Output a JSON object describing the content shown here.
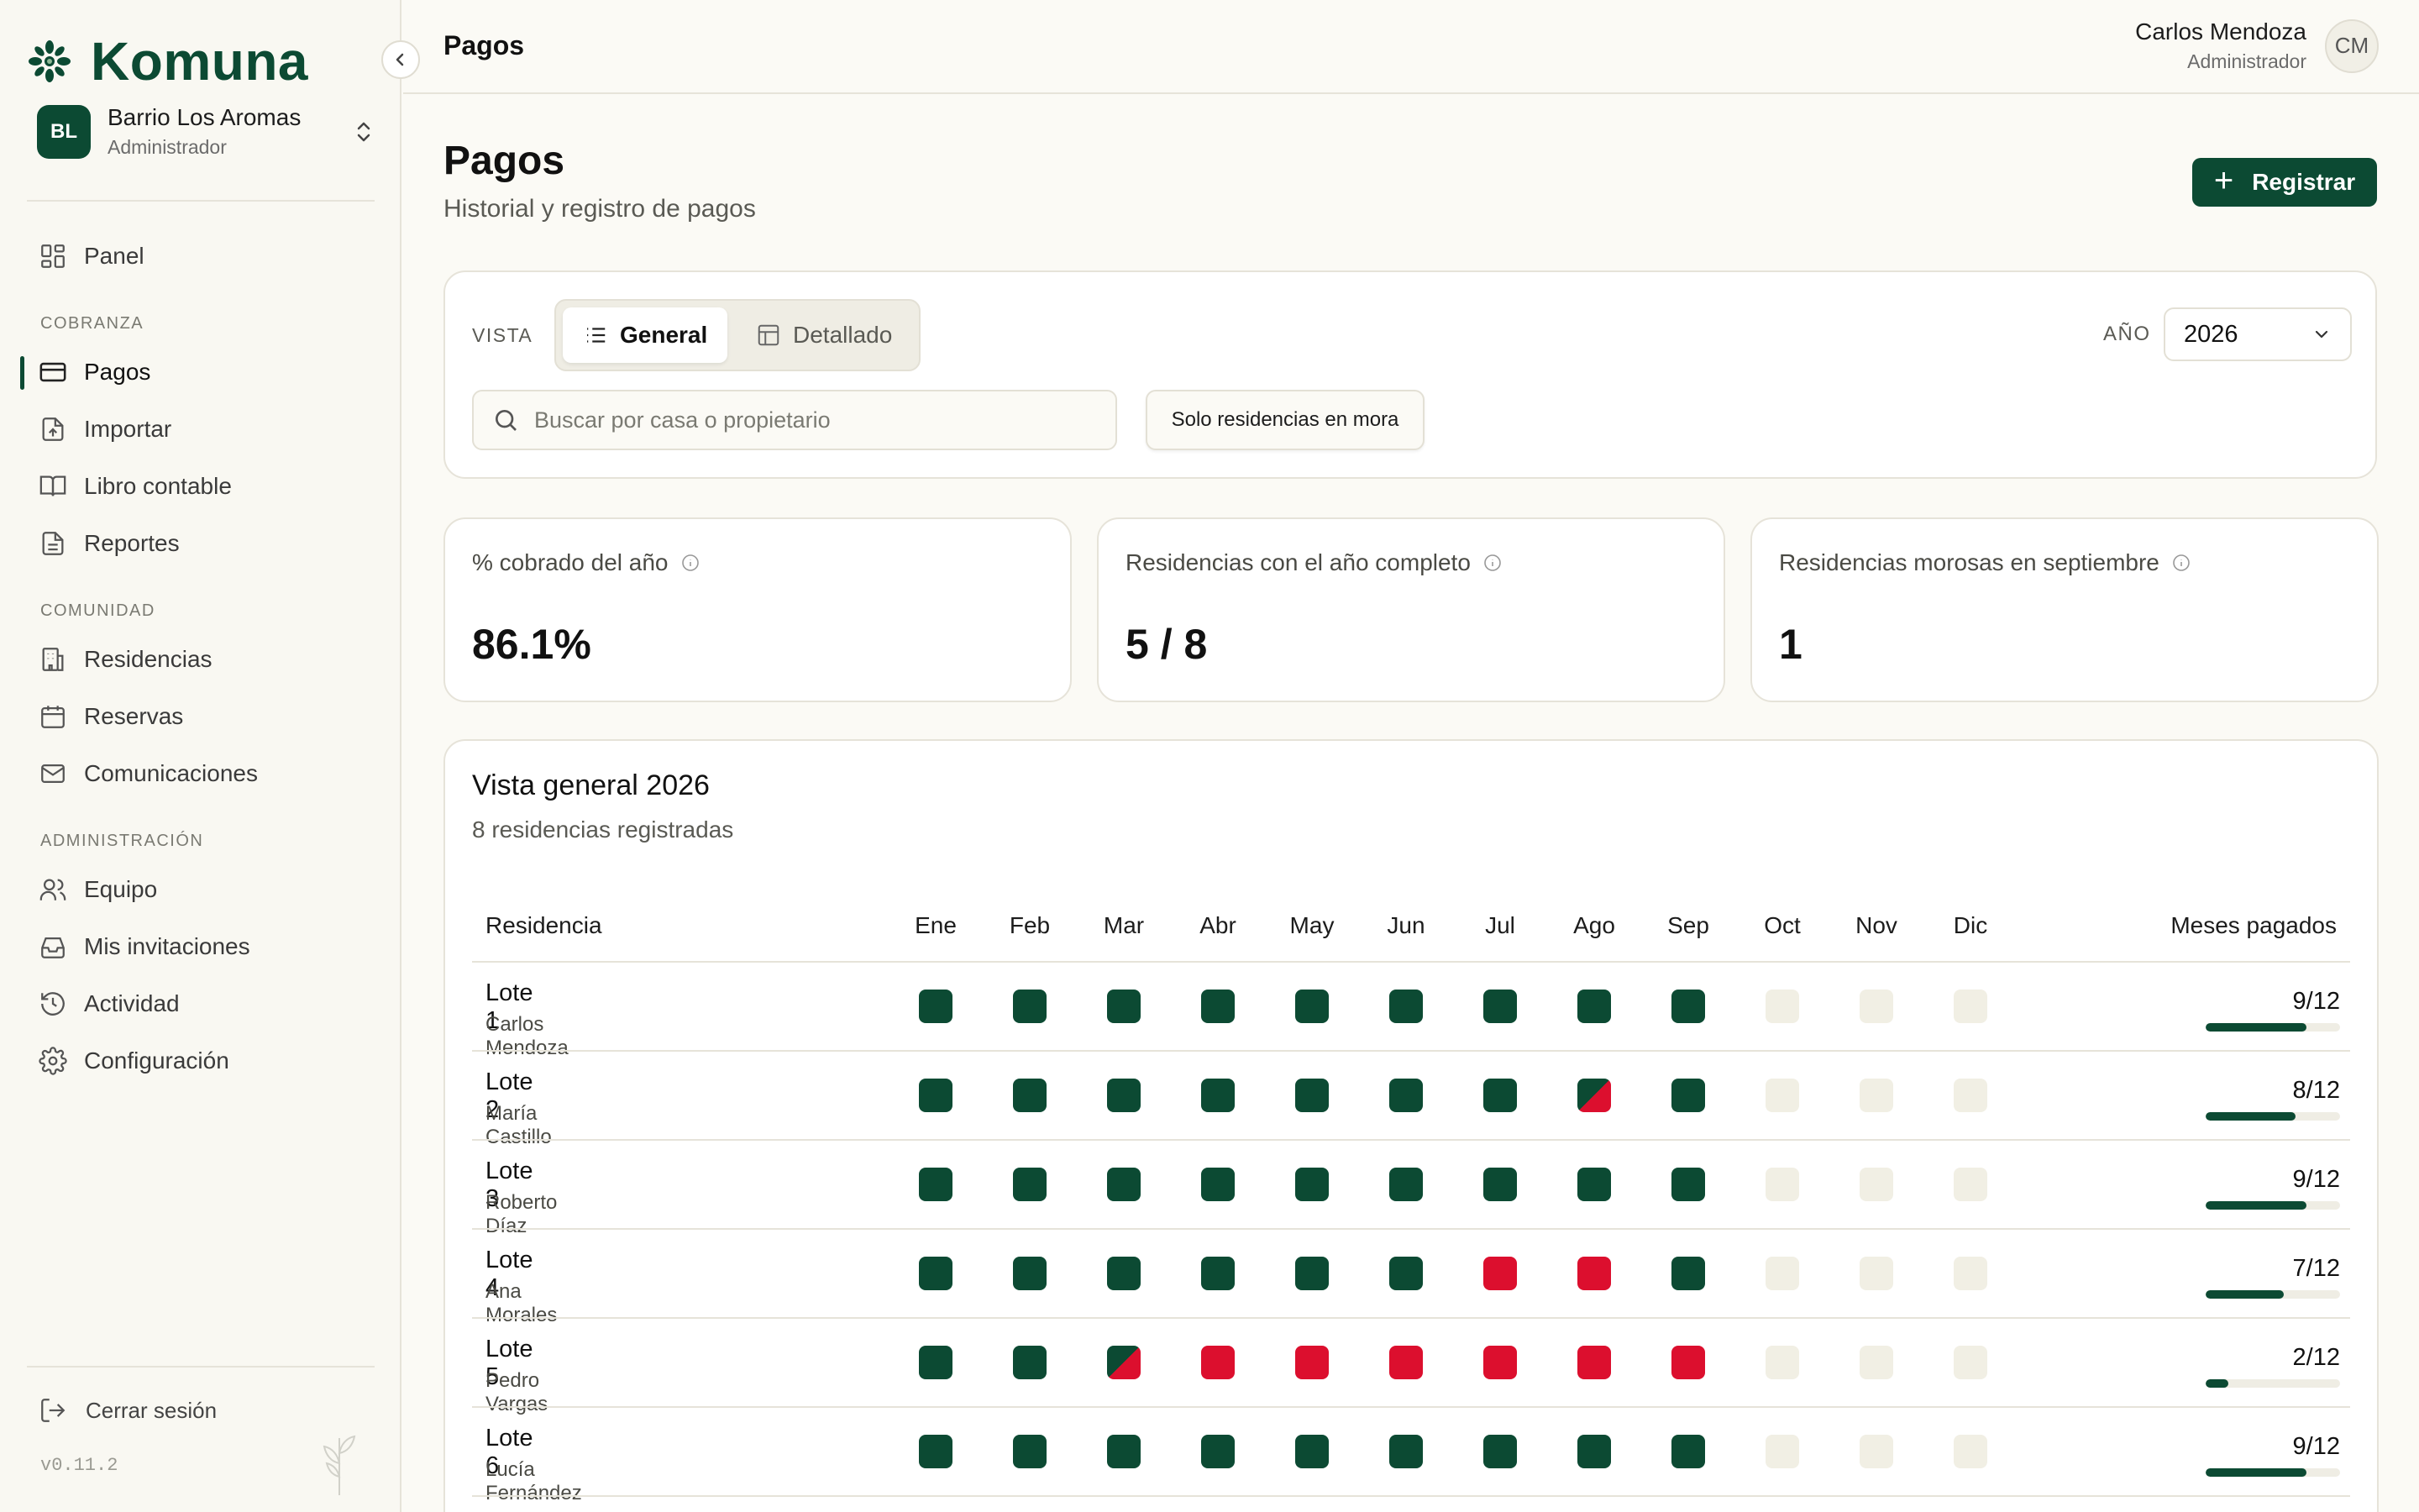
{
  "brand": {
    "name": "Komuna",
    "color": "#0c4a33"
  },
  "org": {
    "initials": "BL",
    "name": "Barrio Los Aromas",
    "role": "Administrador"
  },
  "nav": {
    "top": [
      {
        "label": "Panel",
        "icon": "dashboard-icon"
      }
    ],
    "sections": [
      {
        "title": "COBRANZA",
        "items": [
          {
            "label": "Pagos",
            "icon": "credit-card-icon",
            "active": true
          },
          {
            "label": "Importar",
            "icon": "file-upload-icon"
          },
          {
            "label": "Libro contable",
            "icon": "book-icon"
          },
          {
            "label": "Reportes",
            "icon": "report-icon"
          }
        ]
      },
      {
        "title": "COMUNIDAD",
        "items": [
          {
            "label": "Residencias",
            "icon": "building-icon"
          },
          {
            "label": "Reservas",
            "icon": "calendar-icon"
          },
          {
            "label": "Comunicaciones",
            "icon": "mail-icon"
          }
        ]
      },
      {
        "title": "ADMINISTRACIÓN",
        "items": [
          {
            "label": "Equipo",
            "icon": "users-icon"
          },
          {
            "label": "Mis invitaciones",
            "icon": "inbox-icon"
          },
          {
            "label": "Actividad",
            "icon": "history-icon"
          },
          {
            "label": "Configuración",
            "icon": "gear-icon"
          }
        ]
      }
    ],
    "logout": "Cerrar sesión",
    "version": "v0.11.2"
  },
  "topbar": {
    "title": "Pagos",
    "user_name": "Carlos Mendoza",
    "user_role": "Administrador",
    "user_initials": "CM"
  },
  "page": {
    "title": "Pagos",
    "subtitle": "Historial y registro de pagos",
    "register_label": "Registrar"
  },
  "filters": {
    "vista_label": "VISTA",
    "view_options": [
      "General",
      "Detallado"
    ],
    "selected_view": "General",
    "year_label": "AÑO",
    "year": "2026",
    "search_placeholder": "Buscar por casa o propietario",
    "mora_button": "Solo residencias en mora"
  },
  "stats": [
    {
      "label": "% cobrado del año",
      "value": "86.1%"
    },
    {
      "label": "Residencias con el año completo",
      "value": "5 / 8"
    },
    {
      "label": "Residencias morosas en septiembre",
      "value": "1"
    }
  ],
  "overview": {
    "title": "Vista general 2026",
    "subtitle": "8 residencias registradas",
    "headers": {
      "residence": "Residencia",
      "paid": "Meses pagados"
    },
    "months": [
      "Ene",
      "Feb",
      "Mar",
      "Abr",
      "May",
      "Jun",
      "Jul",
      "Ago",
      "Sep",
      "Oct",
      "Nov",
      "Dic"
    ],
    "status_colors": {
      "paid": "#0c4a33",
      "late": "#dc0f2e",
      "pending": "#f1efe4"
    },
    "rows": [
      {
        "name": "Lote 1",
        "owner": "Carlos Mendoza",
        "status": [
          "paid",
          "paid",
          "paid",
          "paid",
          "paid",
          "paid",
          "paid",
          "paid",
          "paid",
          "pending",
          "pending",
          "pending"
        ],
        "paid": "9/12",
        "paid_fraction": 0.75
      },
      {
        "name": "Lote 2",
        "owner": "María Castillo",
        "status": [
          "paid",
          "paid",
          "paid",
          "paid",
          "paid",
          "paid",
          "paid",
          "partial",
          "paid",
          "pending",
          "pending",
          "pending"
        ],
        "paid": "8/12",
        "paid_fraction": 0.667
      },
      {
        "name": "Lote 3",
        "owner": "Roberto Díaz",
        "status": [
          "paid",
          "paid",
          "paid",
          "paid",
          "paid",
          "paid",
          "paid",
          "paid",
          "paid",
          "pending",
          "pending",
          "pending"
        ],
        "paid": "9/12",
        "paid_fraction": 0.75
      },
      {
        "name": "Lote 4",
        "owner": "Ana Morales",
        "status": [
          "paid",
          "paid",
          "paid",
          "paid",
          "paid",
          "paid",
          "late",
          "late",
          "paid",
          "pending",
          "pending",
          "pending"
        ],
        "paid": "7/12",
        "paid_fraction": 0.583
      },
      {
        "name": "Lote 5",
        "owner": "Pedro Vargas",
        "status": [
          "paid",
          "paid",
          "partial",
          "late",
          "late",
          "late",
          "late",
          "late",
          "late",
          "pending",
          "pending",
          "pending"
        ],
        "paid": "2/12",
        "paid_fraction": 0.167
      },
      {
        "name": "Lote 6",
        "owner": "Lucía Fernández",
        "status": [
          "paid",
          "paid",
          "paid",
          "paid",
          "paid",
          "paid",
          "paid",
          "paid",
          "paid",
          "pending",
          "pending",
          "pending"
        ],
        "paid": "9/12",
        "paid_fraction": 0.75
      }
    ]
  }
}
